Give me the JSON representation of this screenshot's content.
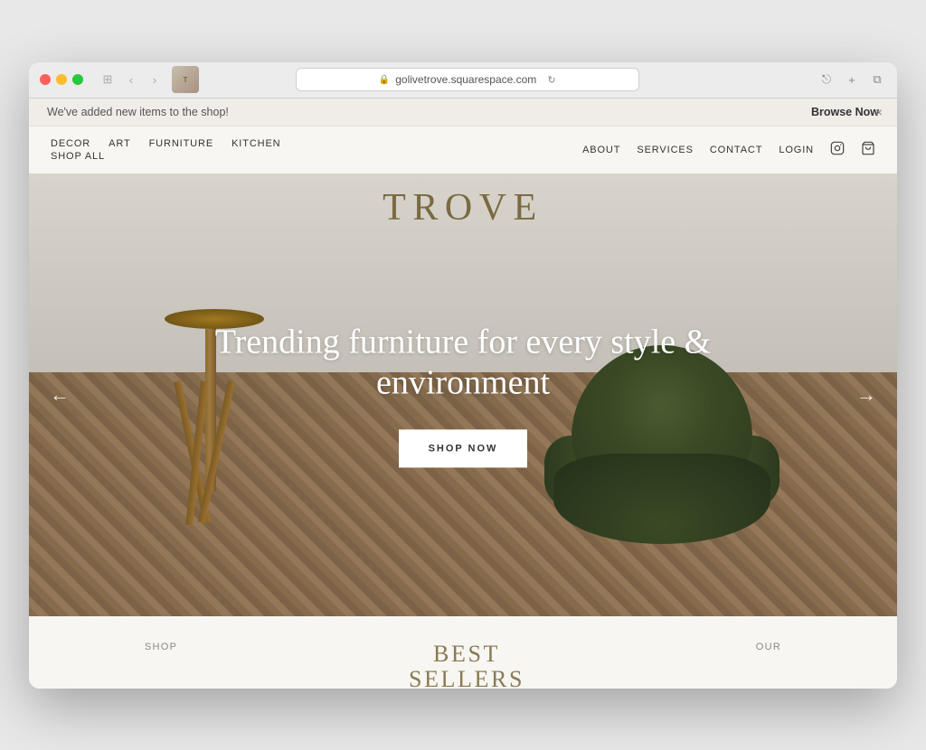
{
  "browser": {
    "url": "golivetrove.squarespace.com",
    "tab_thumbnail_text": "T",
    "back_arrow": "‹",
    "forward_arrow": "›"
  },
  "announcement": {
    "text": "We've added new items to the shop! ",
    "link_text": "Browse Now",
    "close_icon": "×"
  },
  "nav": {
    "left_row1": [
      "DECOR",
      "ART",
      "FURNITURE",
      "KITCHEN"
    ],
    "left_row2": [
      "SHOP ALL"
    ],
    "right_items": [
      "ABOUT",
      "SERVICES",
      "CONTACT",
      "LOGIN"
    ],
    "instagram_icon": "instagram",
    "cart_icon": "cart"
  },
  "hero": {
    "logo": "TROVE",
    "headline": "Trending furniture for every style & environment",
    "cta_label": "SHOP NOW",
    "arrow_left": "←",
    "arrow_right": "→"
  },
  "bottom": {
    "col1_label": "SHOP",
    "col2_title_line1": "BEST",
    "col2_title_line2": "SELLERS",
    "col3_label": "OUR"
  },
  "colors": {
    "accent_gold": "#7a6a40",
    "nav_text": "#333333",
    "hero_overlay_text": "#ffffff",
    "cta_bg": "#ffffff",
    "announcement_bg": "#f0ede8"
  }
}
